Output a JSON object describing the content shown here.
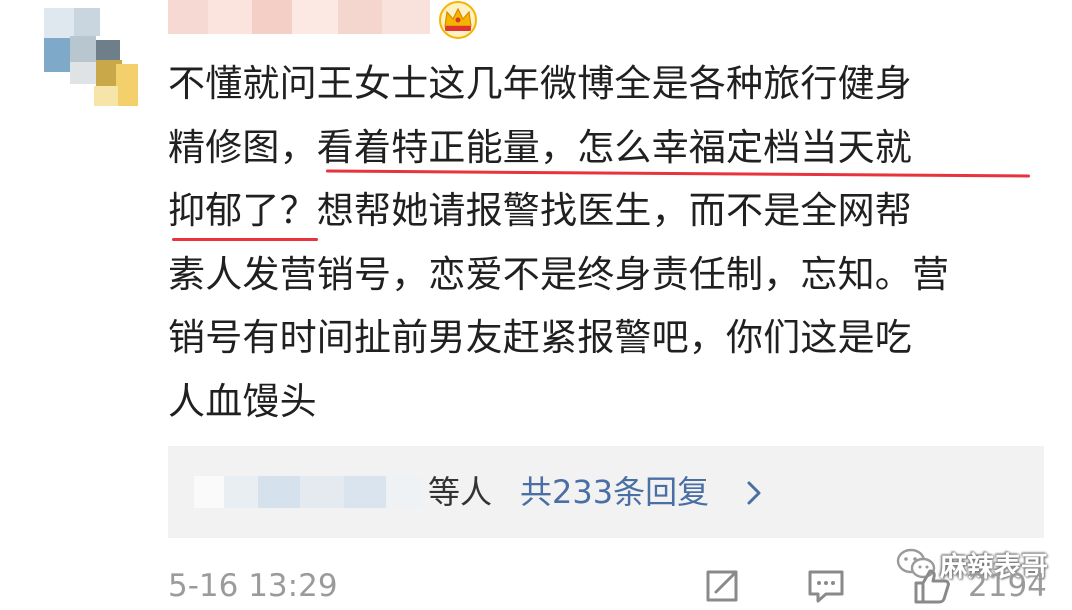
{
  "comment": {
    "lines": [
      "不懂就问王女士这几年微博全是各种旅行健身",
      "精修图，看着特正能量，怎么幸福定档当天就",
      "抑郁了？想帮她请报警找医生，而不是全网帮",
      "素人发营销号，恋爱不是终身责任制，忘知。营",
      "销号有时间扯前男友赶紧报警吧，你们这是吃",
      "人血馒头"
    ]
  },
  "replies": {
    "others_label": "等人",
    "count_label": "共233条回复"
  },
  "meta": {
    "timestamp": "5-16 13:29",
    "like_count": "2194"
  },
  "watermark": {
    "text": "麻辣表哥"
  },
  "icons": {
    "vip": "crown-icon",
    "share": "share-icon",
    "comment": "comment-icon",
    "like": "thumbs-up-icon",
    "chevron": "chevron-right-icon"
  },
  "colors": {
    "underline": "#e8323c",
    "link": "#4a6fa5",
    "meta": "#9b9b9b",
    "reply_bg": "#f2f2f2",
    "badge": "#f4b400"
  }
}
